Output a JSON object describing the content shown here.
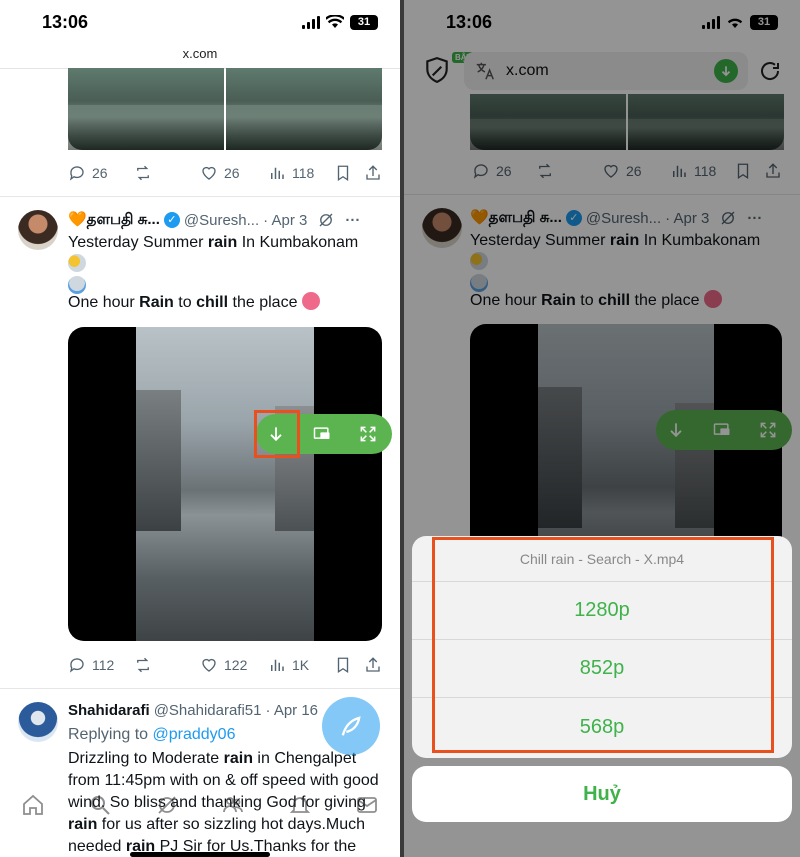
{
  "left": {
    "status": {
      "time": "13:06",
      "battery": "31"
    },
    "url": "x.com",
    "top_tweet_actions": {
      "replies": "26",
      "likes": "26",
      "views": "118"
    },
    "tweet1": {
      "name": "🧡தளபதி சு...",
      "handle": "@Suresh...",
      "date": "· Apr 3",
      "line1_pre": "Yesterday Summer ",
      "line1_bold": "rain",
      "line1_post": " In Kumbakonam",
      "line2_pre": "One hour ",
      "line2_b1": "Rain",
      "line2_mid": " to ",
      "line2_b2": "chill",
      "line2_post": " the place",
      "replies": "112",
      "likes": "122",
      "views": "1K"
    },
    "tweet2": {
      "name": "Shahidarafi",
      "handle": "@Shahidarafi51",
      "date": "· Apr 16",
      "reply_prefix": "Replying to ",
      "reply_to": "@praddy06",
      "body_parts": [
        "Drizzling to Moderate ",
        "rain",
        " in Chengalpet from  11:45pm  with on & off speed with good wind. So bliss and thanking God for giving ",
        "rain",
        " for us after so sizzling hot days.Much needed ",
        "rain",
        " PJ Sir for Us.Thanks for the"
      ]
    }
  },
  "right": {
    "status": {
      "time": "13:06",
      "battery": "31"
    },
    "badge": "BẬT",
    "url": "x.com",
    "top_tweet_actions": {
      "replies": "26",
      "likes": "26",
      "views": "118"
    },
    "tweet1": {
      "name": "🧡தளபதி சு...",
      "handle": "@Suresh...",
      "date": "· Apr 3",
      "line1_pre": "Yesterday Summer ",
      "line1_bold": "rain",
      "line1_post": " In Kumbakonam",
      "line2_pre": "One hour ",
      "line2_b1": "Rain",
      "line2_mid": " to ",
      "line2_b2": "chill",
      "line2_post": " the place"
    },
    "sheet": {
      "title": "Chill rain - Search - X.mp4",
      "options": [
        "1280p",
        "852p",
        "568p"
      ],
      "cancel": "Huỷ"
    }
  },
  "colors": {
    "accent_green": "#3fb24b",
    "highlight_red": "#e8501e",
    "x_blue": "#1d9bf0"
  }
}
